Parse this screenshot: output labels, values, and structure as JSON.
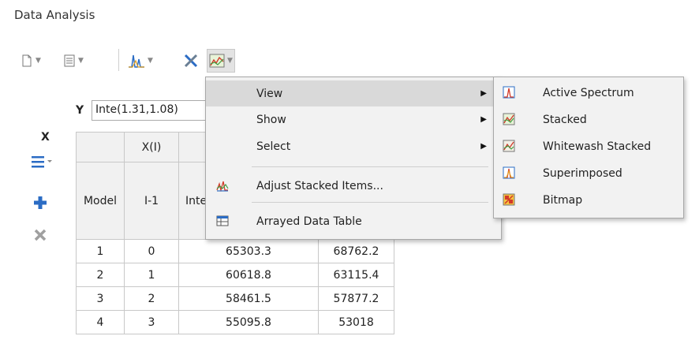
{
  "window": {
    "title": "Data Analysis"
  },
  "toolbar": {
    "buttons": [
      {
        "name": "new-document-icon"
      },
      {
        "name": "worksheet-icon"
      },
      {
        "name": "peak-analysis-icon"
      },
      {
        "name": "tools-icon"
      },
      {
        "name": "chart-view-icon"
      }
    ]
  },
  "y_field": {
    "label": "Y",
    "value": "Inte(1.31,1.08)"
  },
  "side": {
    "x_label": "X"
  },
  "table": {
    "header_top": [
      "",
      "X(I)",
      "",
      ""
    ],
    "header_bottom": [
      "Model",
      "I-1",
      "Inte",
      ""
    ],
    "rows": [
      [
        "1",
        "0",
        "65303.3",
        "68762.2"
      ],
      [
        "2",
        "1",
        "60618.8",
        "63115.4"
      ],
      [
        "3",
        "2",
        "58461.5",
        "57877.2"
      ],
      [
        "4",
        "3",
        "55095.8",
        "53018"
      ]
    ]
  },
  "menu": {
    "items": [
      {
        "label": "View",
        "submenu": true,
        "highlighted": true
      },
      {
        "label": "Show",
        "submenu": true
      },
      {
        "label": "Select",
        "submenu": true
      },
      {
        "label": "Adjust Stacked Items...",
        "icon": "adjust-stacked-icon"
      },
      {
        "label": "Arrayed Data Table",
        "icon": "arrayed-table-icon"
      }
    ],
    "submenu_arrow": "▶"
  },
  "submenu": {
    "items": [
      {
        "label": "Active Spectrum",
        "icon": "active-spectrum-icon"
      },
      {
        "label": "Stacked",
        "icon": "stacked-icon"
      },
      {
        "label": "Whitewash Stacked",
        "icon": "whitewash-stacked-icon"
      },
      {
        "label": "Superimposed",
        "icon": "superimposed-icon"
      },
      {
        "label": "Bitmap",
        "icon": "bitmap-icon"
      }
    ]
  },
  "colors": {
    "accent_blue": "#2b6cc4",
    "red": "#d23a2a",
    "menu_bg": "#f2f2f2",
    "highlight": "#d9d9d9"
  }
}
